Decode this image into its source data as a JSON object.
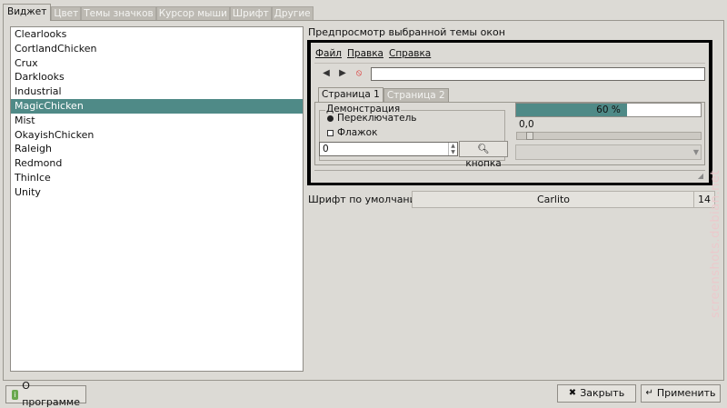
{
  "tabs": [
    "Виджет",
    "Цвет",
    "Темы значков",
    "Курсор мыши",
    "Шрифт",
    "Другие"
  ],
  "active_tab_index": 0,
  "themes": [
    "Clearlooks",
    "CortlandChicken",
    "Crux",
    "Darklooks",
    "Industrial",
    "MagicChicken",
    "Mist",
    "OkayishChicken",
    "Raleigh",
    "Redmond",
    "ThinIce",
    "Unity"
  ],
  "selected_theme": "MagicChicken",
  "preview": {
    "title": "Предпросмотр выбранной темы окон",
    "menu": [
      "Файл",
      "Правка",
      "Справка"
    ],
    "tabs": [
      "Страница 1",
      "Страница 2"
    ],
    "demo_legend": "Демонстрация",
    "radio_label": "Переключатель",
    "check_label": "Флажок",
    "spin_value": "0",
    "button_label": "кнопка",
    "progress_text": "60 %",
    "progress_value": 0.6,
    "scale_value": "0,0"
  },
  "font": {
    "label": "Шрифт по умолчанию:",
    "name": "Carlito",
    "size": "14"
  },
  "buttons": {
    "about": "О программе",
    "close": "Закрыть",
    "apply": "Применить"
  },
  "watermark": "screenshots.debian.net",
  "colors": {
    "selection": "#4f8a87",
    "window_bg": "#dcdad5"
  }
}
